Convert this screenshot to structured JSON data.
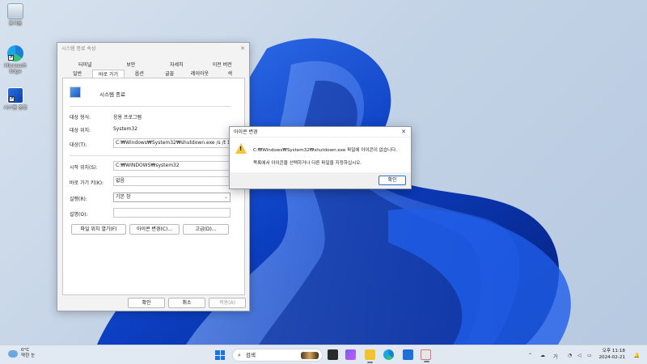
{
  "desktop": {
    "icons": [
      {
        "label": "휴지통",
        "icon": "recycle-bin-icon"
      },
      {
        "label": "Microsoft Edge",
        "icon": "edge-icon"
      },
      {
        "label": "시스템 종료",
        "icon": "shortcut-icon"
      }
    ]
  },
  "properties": {
    "title": "시스템 종료 속성",
    "tabs_row1": [
      "터미널",
      "보안",
      "자세히",
      "이전 버전"
    ],
    "tabs_row2": [
      "일반",
      "바로 가기",
      "옵션",
      "글꼴",
      "레이아웃",
      "색"
    ],
    "active_tab": "바로 가기",
    "app_name": "시스템 종료",
    "target_type_label": "대상 형식:",
    "target_type_value": "응용 프로그램",
    "target_location_label": "대상 위치:",
    "target_location_value": "System32",
    "target_label": "대상(T):",
    "target_value": "C:₩Windows₩System32₩shutdown.exe /s /t 1",
    "start_in_label": "시작 위치(S):",
    "start_in_value": "C:₩WINDOWS₩system32",
    "shortcut_key_label": "바로 가기 키(K):",
    "shortcut_key_value": "없음",
    "run_label": "실행(R):",
    "run_value": "기본 창",
    "comment_label": "설명(O):",
    "comment_value": "",
    "open_location_button": "파일 위치 열기(F)",
    "change_icon_button": "아이콘 변경(C)...",
    "advanced_button": "고급(D)...",
    "ok_button": "확인",
    "cancel_button": "취소",
    "apply_button": "적용(A)"
  },
  "error_dialog": {
    "title": "아이콘 변경",
    "message1": "C:₩Windows₩System32₩shutdown.exe 파일에 아이콘이 없습니다.",
    "message2": "목록에서 아이콘을 선택하거나 다른 파일을 지정하십시오.",
    "ok_button": "확인"
  },
  "taskbar": {
    "weather_temp": "0°C",
    "weather_desc": "약한 눈",
    "search_placeholder": "검색",
    "time": "오후 11:18",
    "date": "2024-02-21",
    "colors": {
      "accent": "#1a73e8",
      "warning": "#f3c43a"
    }
  }
}
